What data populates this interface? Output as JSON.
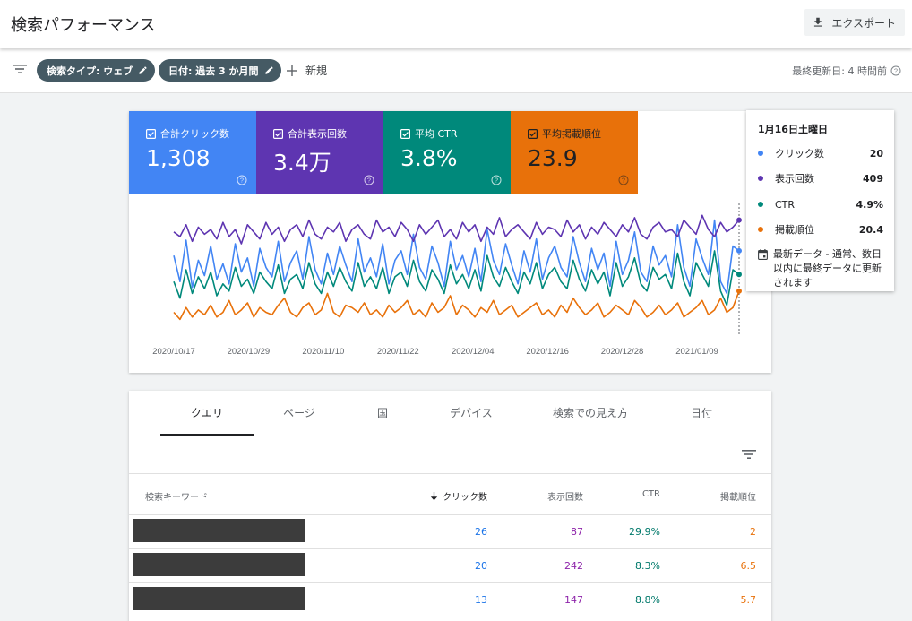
{
  "header": {
    "title": "検索パフォーマンス",
    "export_label": "エクスポート"
  },
  "filters": {
    "chip_search_type": "検索タイプ: ウェブ",
    "chip_date": "日付: 過去 3 か月間",
    "new_label": "新規",
    "last_updated": "最終更新日: 4 時間前"
  },
  "metrics": [
    {
      "label": "合計クリック数",
      "value": "1,308",
      "color": "#4285f4"
    },
    {
      "label": "合計表示回数",
      "value": "3.4万",
      "color": "#5e35b1"
    },
    {
      "label": "平均 CTR",
      "value": "3.8%",
      "color": "#00897b"
    },
    {
      "label": "平均掲載順位",
      "value": "23.9",
      "color": "#e8710a"
    }
  ],
  "tooltip": {
    "date": "1月16日土曜日",
    "rows": [
      {
        "name": "クリック数",
        "value": "20",
        "color": "#4285f4"
      },
      {
        "name": "表示回数",
        "value": "409",
        "color": "#5e35b1"
      },
      {
        "name": "CTR",
        "value": "4.9%",
        "color": "#00897b"
      },
      {
        "name": "掲載順位",
        "value": "20.4",
        "color": "#e8710a"
      }
    ],
    "note": "最新データ - 通常、数日以内に最終データに更新されます"
  },
  "chart_data": {
    "type": "line",
    "x_tick_labels": [
      "2020/10/17",
      "2020/10/29",
      "2020/11/10",
      "2020/11/22",
      "2020/12/04",
      "2020/12/16",
      "2020/12/28",
      "2021/01/09"
    ],
    "grid": false,
    "note_values": "relative indices (0-100) approximated from the plot; series plotted on independent scales",
    "series": [
      {
        "name": "クリック数",
        "color": "#4285f4",
        "values": [
          62,
          40,
          75,
          35,
          58,
          45,
          70,
          42,
          55,
          38,
          72,
          48,
          60,
          36,
          68,
          52,
          44,
          74,
          40,
          56,
          66,
          42,
          78,
          50,
          38,
          64,
          46,
          70,
          54,
          40,
          76,
          48,
          60,
          44,
          72,
          38,
          58,
          66,
          46,
          80,
          52,
          42,
          70,
          56,
          36,
          74,
          50,
          62,
          44,
          68,
          40,
          84,
          58,
          46,
          72,
          54,
          38,
          66,
          48,
          76,
          42,
          60,
          70,
          52,
          44,
          78,
          56,
          40,
          68,
          50,
          64,
          36,
          74,
          46,
          58,
          82,
          48,
          40,
          70,
          54,
          62,
          44,
          88,
          52,
          36,
          76,
          60,
          46,
          92,
          40,
          30,
          70,
          66
        ]
      },
      {
        "name": "表示回数",
        "color": "#5e35b1",
        "values": [
          82,
          78,
          88,
          74,
          86,
          80,
          84,
          76,
          90,
          78,
          84,
          72,
          88,
          82,
          76,
          90,
          80,
          86,
          74,
          84,
          88,
          78,
          92,
          80,
          76,
          86,
          82,
          90,
          74,
          84,
          88,
          80,
          76,
          92,
          82,
          86,
          78,
          90,
          84,
          74,
          88,
          80,
          86,
          92,
          78,
          84,
          76,
          90,
          82,
          88,
          74,
          86,
          80,
          94,
          78,
          84,
          88,
          82,
          76,
          90,
          80,
          86,
          84,
          78,
          92,
          82,
          88,
          76,
          86,
          80,
          90,
          84,
          78,
          88,
          82,
          94,
          80,
          76,
          86,
          90,
          82,
          84,
          78,
          92,
          86,
          80,
          96,
          84,
          78,
          90,
          82,
          86,
          92
        ]
      },
      {
        "name": "CTR",
        "color": "#00897b",
        "values": [
          40,
          26,
          50,
          30,
          44,
          34,
          48,
          28,
          38,
          32,
          52,
          36,
          42,
          30,
          48,
          40,
          34,
          54,
          30,
          42,
          46,
          34,
          56,
          38,
          30,
          48,
          36,
          52,
          40,
          32,
          56,
          36,
          44,
          34,
          52,
          30,
          44,
          48,
          36,
          58,
          40,
          32,
          50,
          42,
          30,
          54,
          38,
          46,
          34,
          50,
          32,
          62,
          44,
          36,
          52,
          40,
          30,
          48,
          38,
          56,
          34,
          46,
          52,
          40,
          34,
          58,
          42,
          32,
          50,
          38,
          48,
          28,
          56,
          36,
          44,
          60,
          38,
          32,
          52,
          42,
          46,
          34,
          64,
          40,
          28,
          56,
          46,
          36,
          66,
          32,
          20,
          50,
          46
        ]
      },
      {
        "name": "掲載順位",
        "color": "#e8710a",
        "values": [
          14,
          8,
          18,
          10,
          16,
          12,
          20,
          10,
          14,
          24,
          12,
          16,
          22,
          10,
          18,
          14,
          12,
          20,
          26,
          14,
          10,
          18,
          22,
          12,
          16,
          30,
          14,
          10,
          20,
          18,
          14,
          22,
          12,
          16,
          10,
          20,
          14,
          18,
          24,
          12,
          16,
          10,
          22,
          14,
          18,
          28,
          12,
          20,
          16,
          10,
          18,
          14,
          24,
          12,
          16,
          20,
          10,
          14,
          18,
          22,
          12,
          16,
          10,
          20,
          14,
          26,
          18,
          12,
          16,
          22,
          10,
          14,
          20,
          16,
          12,
          24,
          18,
          10,
          14,
          20,
          12,
          16,
          22,
          10,
          14,
          18,
          24,
          12,
          16,
          26,
          14,
          18,
          32
        ]
      }
    ]
  },
  "table": {
    "tabs": [
      "クエリ",
      "ページ",
      "国",
      "デバイス",
      "検索での見え方",
      "日付"
    ],
    "active_tab": "クエリ",
    "columns": [
      "検索キーワード",
      "クリック数",
      "表示回数",
      "CTR",
      "掲載順位"
    ],
    "rows": [
      {
        "query": "",
        "clicks": "26",
        "impressions": "87",
        "ctr": "29.9%",
        "position": "2"
      },
      {
        "query": "",
        "clicks": "20",
        "impressions": "242",
        "ctr": "8.3%",
        "position": "6.5"
      },
      {
        "query": "",
        "clicks": "13",
        "impressions": "147",
        "ctr": "8.8%",
        "position": "5.7"
      }
    ]
  }
}
